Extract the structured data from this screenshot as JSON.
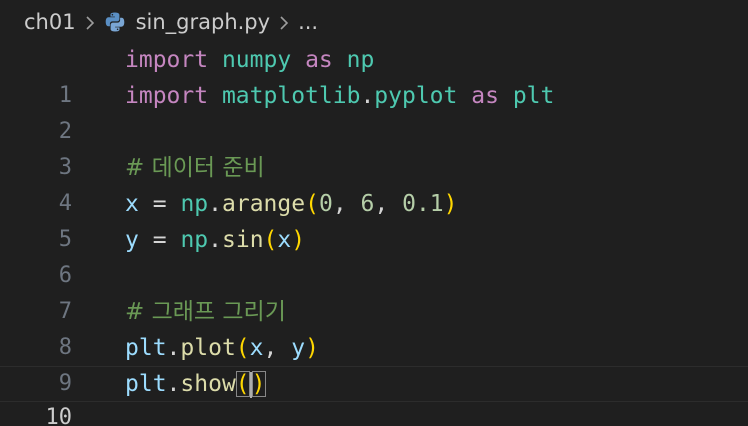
{
  "breadcrumb": {
    "folder": "ch01",
    "file": "sin_graph.py",
    "more": "...",
    "file_icon": "python-icon"
  },
  "editor": {
    "current_line": 10,
    "lines": [
      {
        "num": "1"
      },
      {
        "num": "2"
      },
      {
        "num": "3"
      },
      {
        "num": "4"
      },
      {
        "num": "5"
      },
      {
        "num": "6"
      },
      {
        "num": "7"
      },
      {
        "num": "8"
      },
      {
        "num": "9"
      },
      {
        "num": "10"
      }
    ]
  },
  "tokens": {
    "import": "import",
    "numpy": "numpy",
    "as": "as",
    "np": "np",
    "matplotlib": "matplotlib",
    "dot": ".",
    "pyplot": "pyplot",
    "plt": "plt",
    "comment_data": "# 데이터 준비",
    "x": "x",
    "eq": "=",
    "arange": "arange",
    "lparen": "(",
    "rparen": ")",
    "zero": "0",
    "comma": ",",
    "six": "6",
    "step": "0.1",
    "y": "y",
    "sin": "sin",
    "comment_plot": "# 그래프 그리기",
    "plot": "plot",
    "show": "show"
  },
  "colors": {
    "background": "#1f1f1f",
    "keyword": "#c586c0",
    "namespace": "#4ec9b0",
    "variable": "#9cdcfe",
    "function": "#dcdcaa",
    "number": "#b5cea8",
    "comment": "#6a9955",
    "bracket": "#ffd700"
  }
}
